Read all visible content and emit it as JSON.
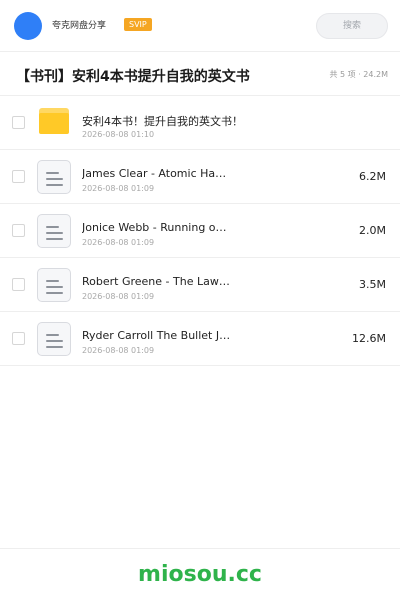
{
  "account": {
    "username": "夸克网盘分享",
    "badge": "SVIP"
  },
  "search": {
    "label": "搜索"
  },
  "folder": {
    "title": "【书刊】安利4本书提升自我的英文书",
    "summary": "共 5 项 · 24.2M"
  },
  "files": [
    {
      "type": "folder",
      "name": "安利4本书！提升自我的英文书！",
      "date": "2026-08-08 01:10",
      "size": ""
    },
    {
      "type": "document",
      "name": "James Clear - Atomic Habits",
      "date": "2026-08-08 01:09",
      "size": "6.2M"
    },
    {
      "type": "document",
      "name": "Jonice Webb - Running on Empty",
      "date": "2026-08-08 01:09",
      "size": "2.0M"
    },
    {
      "type": "document",
      "name": "Robert Greene - The Laws of Human Nature",
      "date": "2026-08-08 01:09",
      "size": "3.5M"
    },
    {
      "type": "document",
      "name": "Ryder Carroll The Bullet Journal Method",
      "date": "2026-08-08 01:09",
      "size": "12.6M"
    }
  ],
  "watermark": "miosou.cc",
  "colors": {
    "avatar": "#2f7ff7",
    "svip": "#f5a623",
    "folder": "#ffc927",
    "watermark": "#2fb34b"
  }
}
